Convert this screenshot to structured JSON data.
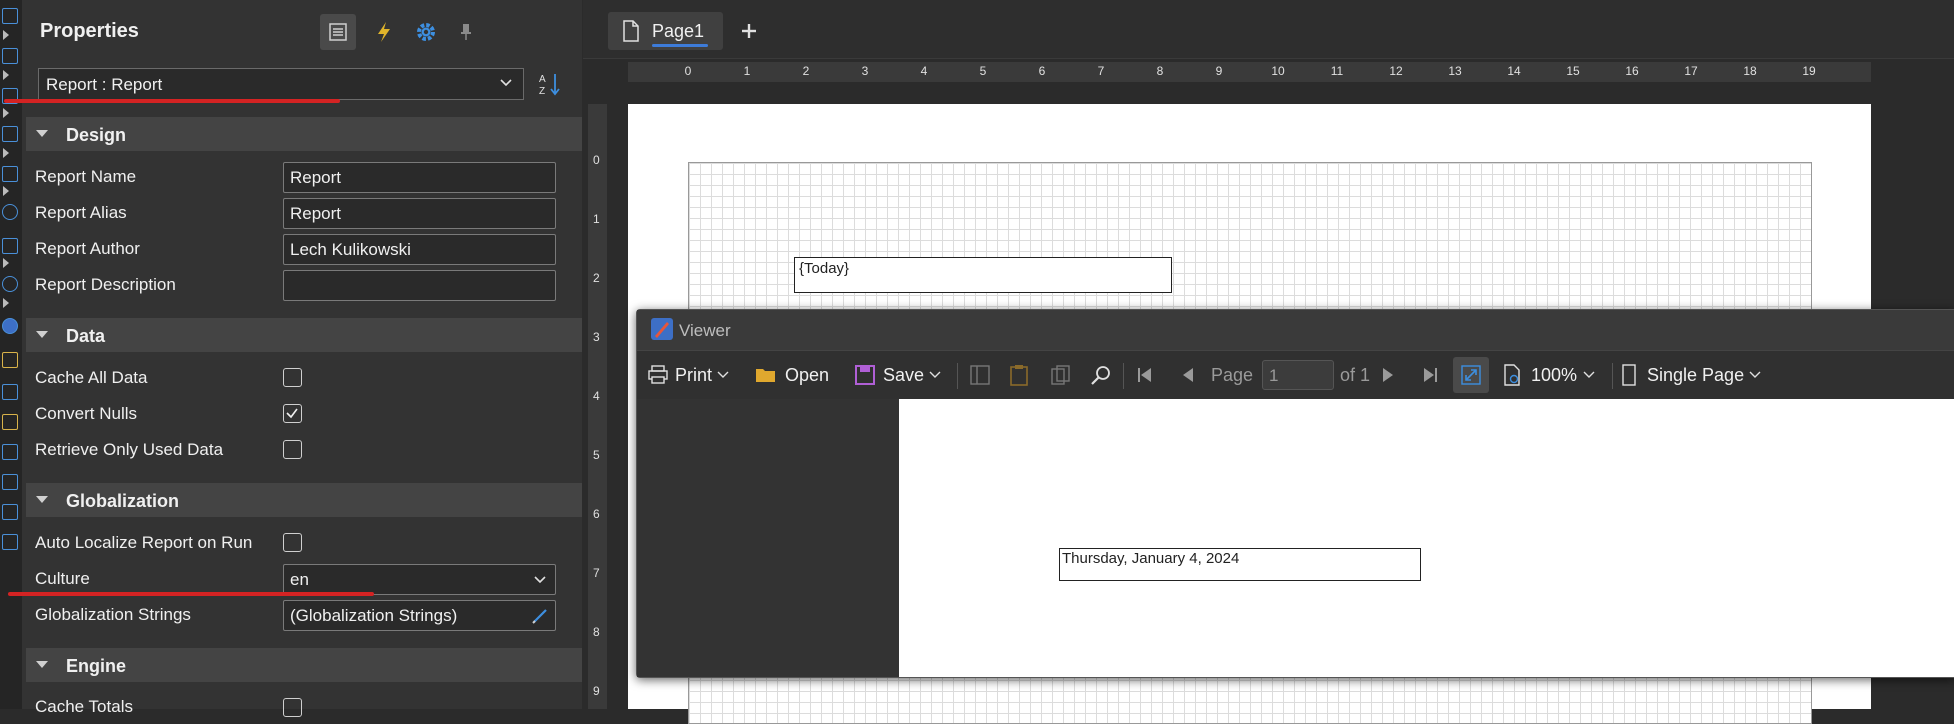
{
  "properties": {
    "title": "Properties",
    "selected_object": "Report : Report",
    "categories": {
      "design": "Design",
      "data": "Data",
      "globalization": "Globalization",
      "engine": "Engine"
    },
    "design": {
      "report_name_label": "Report Name",
      "report_name_value": "Report",
      "report_alias_label": "Report Alias",
      "report_alias_value": "Report",
      "report_author_label": "Report Author",
      "report_author_value": "Lech Kulikowski",
      "report_description_label": "Report Description",
      "report_description_value": ""
    },
    "data": {
      "cache_all_data_label": "Cache All Data",
      "cache_all_data_checked": false,
      "convert_nulls_label": "Convert Nulls",
      "convert_nulls_checked": true,
      "retrieve_only_used_label": "Retrieve Only Used Data",
      "retrieve_only_used_checked": false
    },
    "globalization": {
      "auto_localize_label": "Auto Localize Report on Run",
      "auto_localize_checked": false,
      "culture_label": "Culture",
      "culture_value": "en",
      "strings_label": "Globalization Strings",
      "strings_value": "(Globalization Strings)"
    },
    "engine": {
      "cache_totals_label": "Cache Totals"
    }
  },
  "designer": {
    "tab_label": "Page1",
    "ruler_h": [
      "0",
      "1",
      "2",
      "3",
      "4",
      "5",
      "6",
      "7",
      "8",
      "9",
      "10",
      "11",
      "12",
      "13",
      "14",
      "15",
      "16",
      "17",
      "18",
      "19"
    ],
    "ruler_v": [
      "0",
      "1",
      "2",
      "3",
      "4",
      "5",
      "6",
      "7",
      "8",
      "9"
    ],
    "today_field": "{Today}"
  },
  "viewer": {
    "title": "Viewer",
    "print_label": "Print",
    "open_label": "Open",
    "save_label": "Save",
    "page_label": "Page",
    "page_value": "1",
    "page_of": "of 1",
    "zoom_value": "100%",
    "view_mode": "Single Page",
    "date_text": "Thursday, January 4, 2024"
  },
  "colors": {
    "accent": "#3d7bd8",
    "annotation_red": "#d42323",
    "event_icon": "#e0b42a"
  }
}
